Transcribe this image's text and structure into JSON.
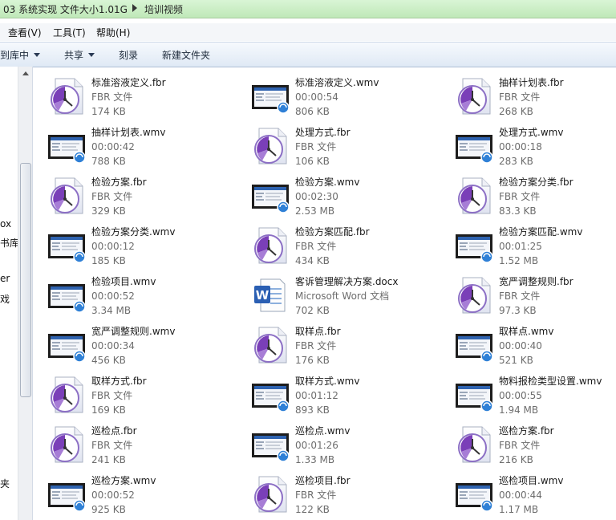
{
  "address_bar": {
    "path": "03 系统实现 文件大小1.01G",
    "current": "培训视频"
  },
  "menu": {
    "items": [
      "查看(V)",
      "工具(T)",
      "帮助(H)"
    ]
  },
  "toolbar": {
    "library": "到库中",
    "share": "共享",
    "burn": "刻录",
    "new_folder": "新建文件夹"
  },
  "nav_pane": {
    "labels": [
      "ox",
      "书库",
      "er",
      "戏",
      "夹"
    ]
  },
  "files": [
    {
      "name": "标准溶液定义.fbr",
      "line2": "FBR 文件",
      "line3": "174 KB",
      "icon": "fbr-clock-icon"
    },
    {
      "name": "标准溶液定义.wmv",
      "line2": "00:00:54",
      "line3": "806 KB",
      "icon": "wmv-video-thumbnail-icon"
    },
    {
      "name": "抽样计划表.fbr",
      "line2": "FBR 文件",
      "line3": "268 KB",
      "icon": "fbr-clock-icon"
    },
    {
      "name": "抽样计划表.wmv",
      "line2": "00:00:42",
      "line3": "788 KB",
      "icon": "wmv-video-thumbnail-icon"
    },
    {
      "name": "处理方式.fbr",
      "line2": "FBR 文件",
      "line3": "106 KB",
      "icon": "fbr-clock-icon"
    },
    {
      "name": "处理方式.wmv",
      "line2": "00:00:18",
      "line3": "283 KB",
      "icon": "wmv-video-thumbnail-icon"
    },
    {
      "name": "检验方案.fbr",
      "line2": "FBR 文件",
      "line3": "329 KB",
      "icon": "fbr-clock-icon"
    },
    {
      "name": "检验方案.wmv",
      "line2": "00:02:30",
      "line3": "2.53 MB",
      "icon": "wmv-video-thumbnail-icon"
    },
    {
      "name": "检验方案分类.fbr",
      "line2": "FBR 文件",
      "line3": "83.3 KB",
      "icon": "fbr-clock-icon"
    },
    {
      "name": "检验方案分类.wmv",
      "line2": "00:00:12",
      "line3": "185 KB",
      "icon": "wmv-video-thumbnail-icon"
    },
    {
      "name": "检验方案匹配.fbr",
      "line2": "FBR 文件",
      "line3": "434 KB",
      "icon": "fbr-clock-icon"
    },
    {
      "name": "检验方案匹配.wmv",
      "line2": "00:01:25",
      "line3": "1.52 MB",
      "icon": "wmv-video-thumbnail-icon"
    },
    {
      "name": "检验项目.wmv",
      "line2": "00:00:52",
      "line3": "3.34 MB",
      "icon": "wmv-video-thumbnail-icon"
    },
    {
      "name": "客诉管理解决方案.docx",
      "line2": "Microsoft Word 文档",
      "line3": "702 KB",
      "icon": "word-document-icon"
    },
    {
      "name": "宽严调整规则.fbr",
      "line2": "FBR 文件",
      "line3": "97.3 KB",
      "icon": "fbr-clock-icon"
    },
    {
      "name": "宽严调整规则.wmv",
      "line2": "00:00:34",
      "line3": "456 KB",
      "icon": "wmv-video-thumbnail-icon"
    },
    {
      "name": "取样点.fbr",
      "line2": "FBR 文件",
      "line3": "176 KB",
      "icon": "fbr-clock-icon"
    },
    {
      "name": "取样点.wmv",
      "line2": "00:00:40",
      "line3": "521 KB",
      "icon": "wmv-video-thumbnail-icon"
    },
    {
      "name": "取样方式.fbr",
      "line2": "FBR 文件",
      "line3": "169 KB",
      "icon": "fbr-clock-icon"
    },
    {
      "name": "取样方式.wmv",
      "line2": "00:01:12",
      "line3": "893 KB",
      "icon": "wmv-video-thumbnail-icon"
    },
    {
      "name": "物料报检类型设置.wmv",
      "line2": "00:00:55",
      "line3": "1.94 MB",
      "icon": "wmv-video-thumbnail-icon"
    },
    {
      "name": "巡检点.fbr",
      "line2": "FBR 文件",
      "line3": "241 KB",
      "icon": "fbr-clock-icon"
    },
    {
      "name": "巡检点.wmv",
      "line2": "00:01:26",
      "line3": "1.33 MB",
      "icon": "wmv-video-thumbnail-icon"
    },
    {
      "name": "巡检方案.fbr",
      "line2": "FBR 文件",
      "line3": "216 KB",
      "icon": "fbr-clock-icon"
    },
    {
      "name": "巡检方案.wmv",
      "line2": "00:00:52",
      "line3": "925 KB",
      "icon": "wmv-video-thumbnail-icon"
    },
    {
      "name": "巡检项目.fbr",
      "line2": "FBR 文件",
      "line3": "122 KB",
      "icon": "fbr-clock-icon"
    },
    {
      "name": "巡检项目.wmv",
      "line2": "00:00:44",
      "line3": "1.17 MB",
      "icon": "wmv-video-thumbnail-icon"
    }
  ]
}
